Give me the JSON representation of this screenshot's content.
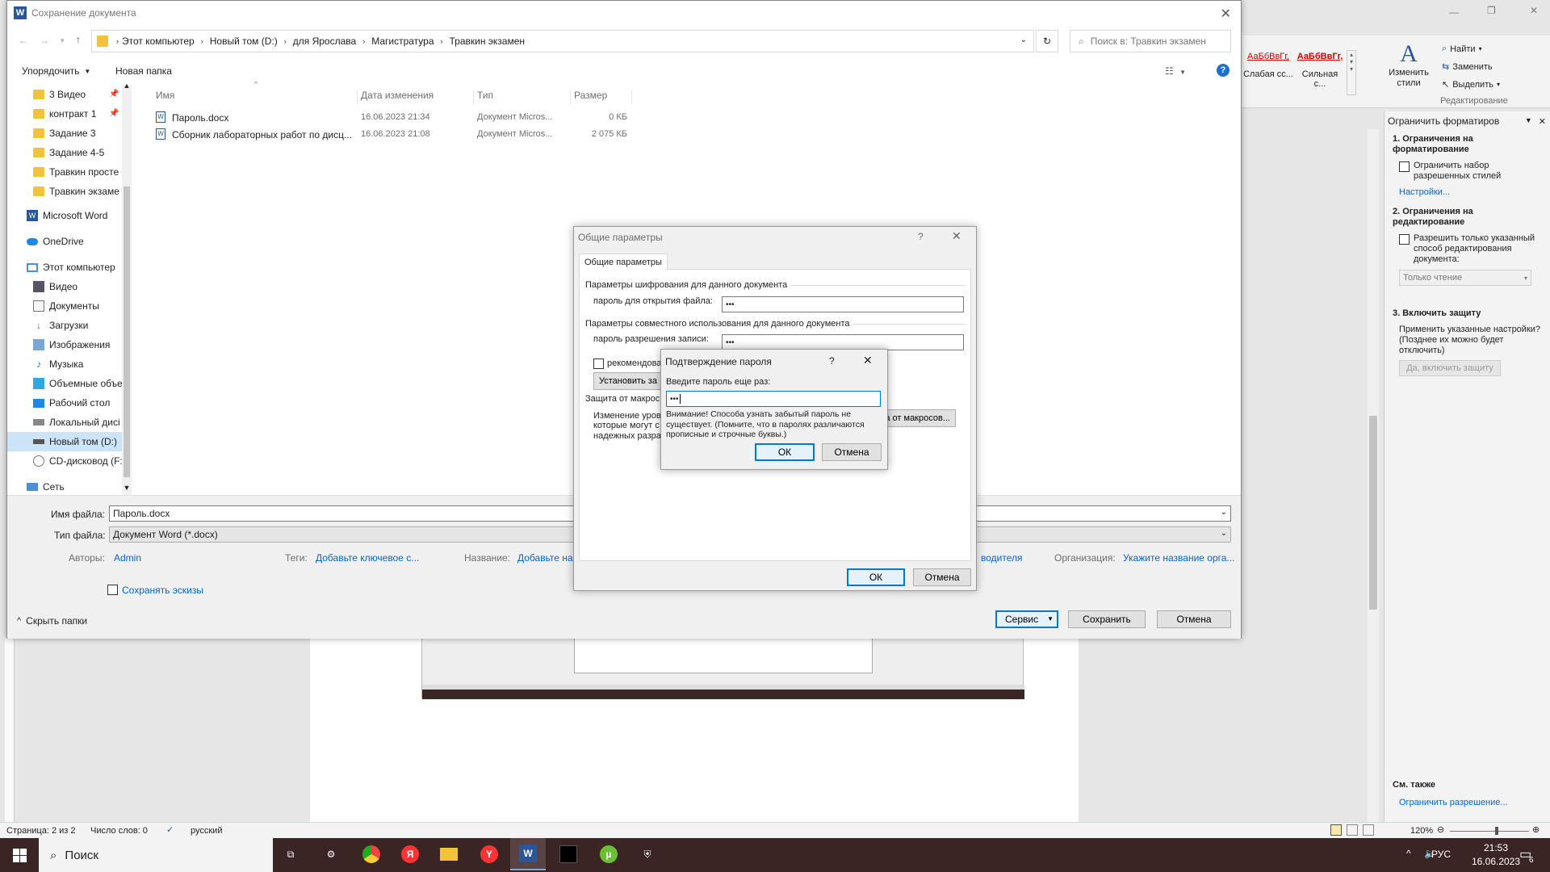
{
  "save_dialog": {
    "title": "Сохранение документа",
    "breadcrumb": [
      "Этот компьютер",
      "Новый том (D:)",
      "для Ярослава",
      "Магистратура",
      "Травкин экзамен"
    ],
    "search_placeholder": "Поиск в: Травкин экзамен",
    "organize_label": "Упорядочить",
    "new_folder_label": "Новая папка",
    "columns": [
      "Имя",
      "Дата изменения",
      "Тип",
      "Размер"
    ],
    "files": [
      {
        "name": "Пароль.docx",
        "date": "16.06.2023 21:34",
        "type": "Документ Micros...",
        "size": "0 КБ"
      },
      {
        "name": "Сборник лабораторных работ по дисц...",
        "date": "16.06.2023 21:08",
        "type": "Документ Micros...",
        "size": "2 075 КБ"
      }
    ],
    "nav_items": [
      {
        "label": "3 Видео",
        "icon": "folder-icon",
        "pinned": true
      },
      {
        "label": "контракт 1",
        "icon": "folder-icon",
        "pinned": true
      },
      {
        "label": "Задание 3",
        "icon": "folder-icon",
        "pinned": false
      },
      {
        "label": "Задание 4-5",
        "icon": "folder-icon",
        "pinned": false
      },
      {
        "label": "Травкин просте",
        "icon": "folder-icon",
        "pinned": false
      },
      {
        "label": "Травкин экзаме",
        "icon": "folder-icon",
        "pinned": false
      },
      {
        "label": "Microsoft Word",
        "icon": "word-icon",
        "pinned": false
      },
      {
        "label": "OneDrive",
        "icon": "cloud-icon",
        "pinned": false
      },
      {
        "label": "Этот компьютер",
        "icon": "computer-icon",
        "pinned": false
      },
      {
        "label": "Видео",
        "icon": "video-icon",
        "pinned": false
      },
      {
        "label": "Документы",
        "icon": "documents-icon",
        "pinned": false
      },
      {
        "label": "Загрузки",
        "icon": "download-icon",
        "pinned": false
      },
      {
        "label": "Изображения",
        "icon": "pictures-icon",
        "pinned": false
      },
      {
        "label": "Музыка",
        "icon": "music-icon",
        "pinned": false
      },
      {
        "label": "Объемные объе",
        "icon": "3d-objects-icon",
        "pinned": false
      },
      {
        "label": "Рабочий стол",
        "icon": "desktop-icon",
        "pinned": false
      },
      {
        "label": "Локальный дисі",
        "icon": "drive-icon",
        "pinned": false
      },
      {
        "label": "Новый том (D:)",
        "icon": "drive-icon",
        "pinned": false
      },
      {
        "label": "CD-дисковод (F:",
        "icon": "cd-icon",
        "pinned": false
      },
      {
        "label": "Сеть",
        "icon": "network-icon",
        "pinned": false
      }
    ],
    "filename_label": "Имя файла:",
    "filename_value": "Пароль.docx",
    "filetype_label": "Тип файла:",
    "filetype_value": "Документ Word (*.docx)",
    "authors_label": "Авторы:",
    "authors_value": "Admin",
    "tags_label": "Теги:",
    "tags_value": "Добавьте ключевое с...",
    "title_label": "Название:",
    "title_value": "Добавьте наз",
    "manager_value": "водителя",
    "org_label": "Организация:",
    "org_value": "Укажите название орга...",
    "thumbnails_label": "Сохранять эскизы",
    "hide_folders_label": "Скрыть папки",
    "service_label": "Сервис",
    "save_label": "Сохранить",
    "cancel_label": "Отмена"
  },
  "general_options": {
    "title": "Общие параметры",
    "help": "?",
    "tab": "Общие параметры",
    "encryption_header": "Параметры шифрования для данного документа",
    "open_password_label": "пароль для открытия файла:",
    "open_password_value": "•••",
    "sharing_header": "Параметры совместного использования для данного документа",
    "write_password_label": "пароль разрешения записи:",
    "write_password_value": "•••",
    "recommend_label": "рекомендова",
    "protect_button": "Установить за",
    "macro_header": "Защита от макрос",
    "macro_text_1": "Изменение уровн",
    "macro_text_2": "которые могут с",
    "macro_text_3": "надежных разра",
    "macro_button": "а от макросов...",
    "ok_label": "ОК",
    "cancel_label": "Отмена"
  },
  "confirm_password": {
    "title": "Подтверждение пароля",
    "help": "?",
    "prompt": "Введите пароль еще раз:",
    "value": "•••",
    "warning": "Внимание! Способа узнать забытый пароль не существует. (Помните, что в паролях различаются прописные и строчные буквы.)",
    "ok_label": "ОК",
    "cancel_label": "Отмена"
  },
  "ribbon": {
    "style_1": "АаБбВвГг,",
    "style_1_caption": "Слабая сс...",
    "style_2": "АаБбВвГг,",
    "style_2_caption": "Сильная с...",
    "change_styles": "Изменить стили",
    "find": "Найти",
    "replace": "Заменить",
    "select": "Выделить",
    "group_label": "Редактирование"
  },
  "restrict_pane": {
    "title": "Ограничить форматиров",
    "s1_title": "1. Ограничения на форматирование",
    "s1_checkbox": "Ограничить набор разрешенных стилей",
    "s1_link": "Настройки...",
    "s2_title": "2. Ограничения на редактирование",
    "s2_checkbox": "Разрешить только указанный способ редактирования документа:",
    "s2_select": "Только чтение",
    "s3_title": "3. Включить защиту",
    "s3_text": "Применить указанные настройки? (Позднее их можно будет отключить)",
    "s3_button": "Да, включить защиту",
    "see_also": "См. также",
    "see_also_link": "Ограничить разрешение..."
  },
  "status_bar": {
    "page": "Страница: 2 из 2",
    "words": "Число слов: 0",
    "language": "русский",
    "zoom": "120%"
  },
  "taskbar": {
    "search_placeholder": "Поиск",
    "lang": "РУС",
    "time": "21:53",
    "date": "16.06.2023",
    "notif_count": "6"
  }
}
